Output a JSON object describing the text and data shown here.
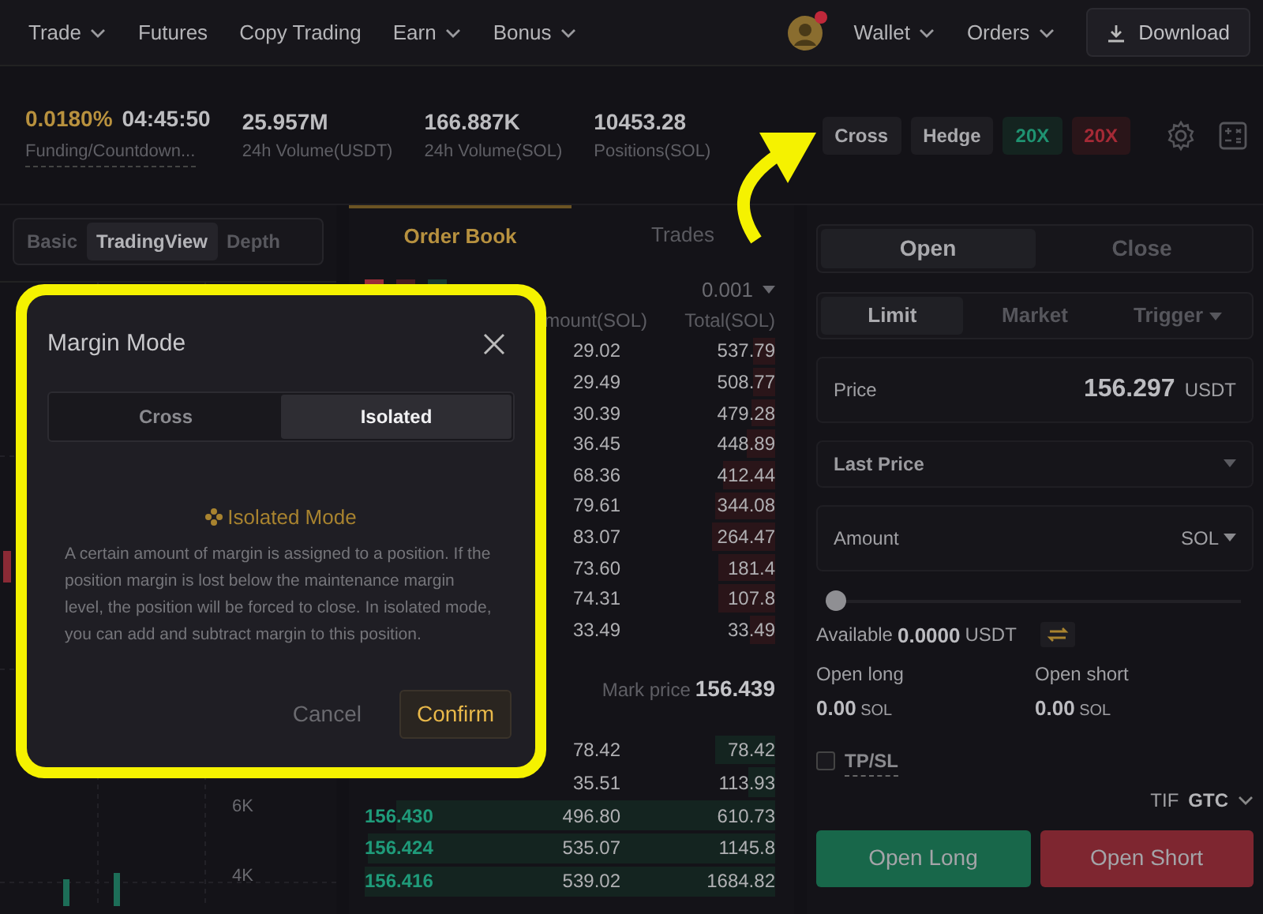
{
  "nav": {
    "items": [
      {
        "label": "Trade",
        "dropdown": true
      },
      {
        "label": "Futures",
        "dropdown": false
      },
      {
        "label": "Copy Trading",
        "dropdown": false
      },
      {
        "label": "Earn",
        "dropdown": true
      },
      {
        "label": "Bonus",
        "dropdown": true
      }
    ],
    "notification": true,
    "menus": [
      {
        "label": "Wallet"
      },
      {
        "label": "Orders"
      }
    ],
    "download": "Download"
  },
  "ticker": {
    "funding_rate": "0.0180%",
    "countdown": "04:45:50",
    "funding_label": "Funding/Countdown...",
    "stats": [
      {
        "value": "25.957M",
        "label": "24h Volume(USDT)"
      },
      {
        "value": "166.887K",
        "label": "24h Volume(SOL)"
      },
      {
        "value": "10453.28",
        "label": "Positions(SOL)"
      }
    ],
    "mode_buttons": [
      {
        "label": "Cross",
        "kind": "neutral"
      },
      {
        "label": "Hedge",
        "kind": "neutral"
      },
      {
        "label": "20X",
        "kind": "long"
      },
      {
        "label": "20X",
        "kind": "short"
      }
    ]
  },
  "chart_panel": {
    "tabs": [
      {
        "label": "Basic",
        "selected": false
      },
      {
        "label": "TradingView",
        "selected": true
      },
      {
        "label": "Depth",
        "selected": false
      }
    ],
    "axis_labels": [
      "6K",
      "4K"
    ]
  },
  "order_book": {
    "tabs": [
      {
        "label": "Order Book",
        "selected": true
      },
      {
        "label": "Trades",
        "selected": false
      }
    ],
    "precision": "0.001",
    "columns": [
      "mount(SOL)",
      "Total(SOL)"
    ],
    "asks": [
      {
        "amount": "29.02",
        "total": "537.79"
      },
      {
        "amount": "29.49",
        "total": "508.77"
      },
      {
        "amount": "30.39",
        "total": "479.28"
      },
      {
        "amount": "36.45",
        "total": "448.89"
      },
      {
        "amount": "68.36",
        "total": "412.44"
      },
      {
        "amount": "79.61",
        "total": "344.08"
      },
      {
        "amount": "83.07",
        "total": "264.47"
      },
      {
        "amount": "73.60",
        "total": "181.4"
      },
      {
        "amount": "74.31",
        "total": "107.8"
      },
      {
        "amount": "33.49",
        "total": "33.49"
      }
    ],
    "mark_price_label": "Mark price",
    "mark_price": "156.439",
    "bids": [
      {
        "amount": "78.42",
        "total": "78.42"
      },
      {
        "amount": "35.51",
        "total": "113.93"
      },
      {
        "price": "156.430",
        "amount": "496.80",
        "total": "610.73"
      },
      {
        "price": "156.424",
        "amount": "535.07",
        "total": "1145.8"
      },
      {
        "price": "156.416",
        "amount": "539.02",
        "total": "1684.82"
      }
    ]
  },
  "trade_panel": {
    "side_tabs": [
      {
        "label": "Open",
        "selected": true
      },
      {
        "label": "Close",
        "selected": false
      }
    ],
    "order_types": [
      {
        "label": "Limit",
        "selected": true,
        "dropdown": false
      },
      {
        "label": "Market",
        "selected": false,
        "dropdown": false
      },
      {
        "label": "Trigger",
        "selected": false,
        "dropdown": true
      }
    ],
    "price": {
      "label": "Price",
      "value": "156.297",
      "unit": "USDT"
    },
    "price_type": "Last Price",
    "amount": {
      "label": "Amount",
      "unit": "SOL"
    },
    "slider": {
      "level": 0
    },
    "available": {
      "label": "Available",
      "value": "0.0000",
      "unit": "USDT"
    },
    "open_long": {
      "label": "Open long",
      "value": "0.00",
      "unit": "SOL"
    },
    "open_short": {
      "label": "Open short",
      "value": "0.00",
      "unit": "SOL"
    },
    "tpsl": {
      "label": "TP/SL",
      "checked": false
    },
    "tif": {
      "label": "TIF",
      "value": "GTC"
    },
    "buttons": [
      {
        "label": "Open Long",
        "kind": "long"
      },
      {
        "label": "Open Short",
        "kind": "short"
      }
    ]
  },
  "modal": {
    "title": "Margin Mode",
    "options": [
      {
        "label": "Cross",
        "selected": false
      },
      {
        "label": "Isolated",
        "selected": true
      }
    ],
    "heading": "Isolated Mode",
    "description": "A certain amount of margin is assigned to a position. If the position margin is lost below the maintenance margin level, the position will be forced to close. In isolated mode, you can add and subtract margin to this position.",
    "cancel": "Cancel",
    "confirm": "Confirm"
  }
}
